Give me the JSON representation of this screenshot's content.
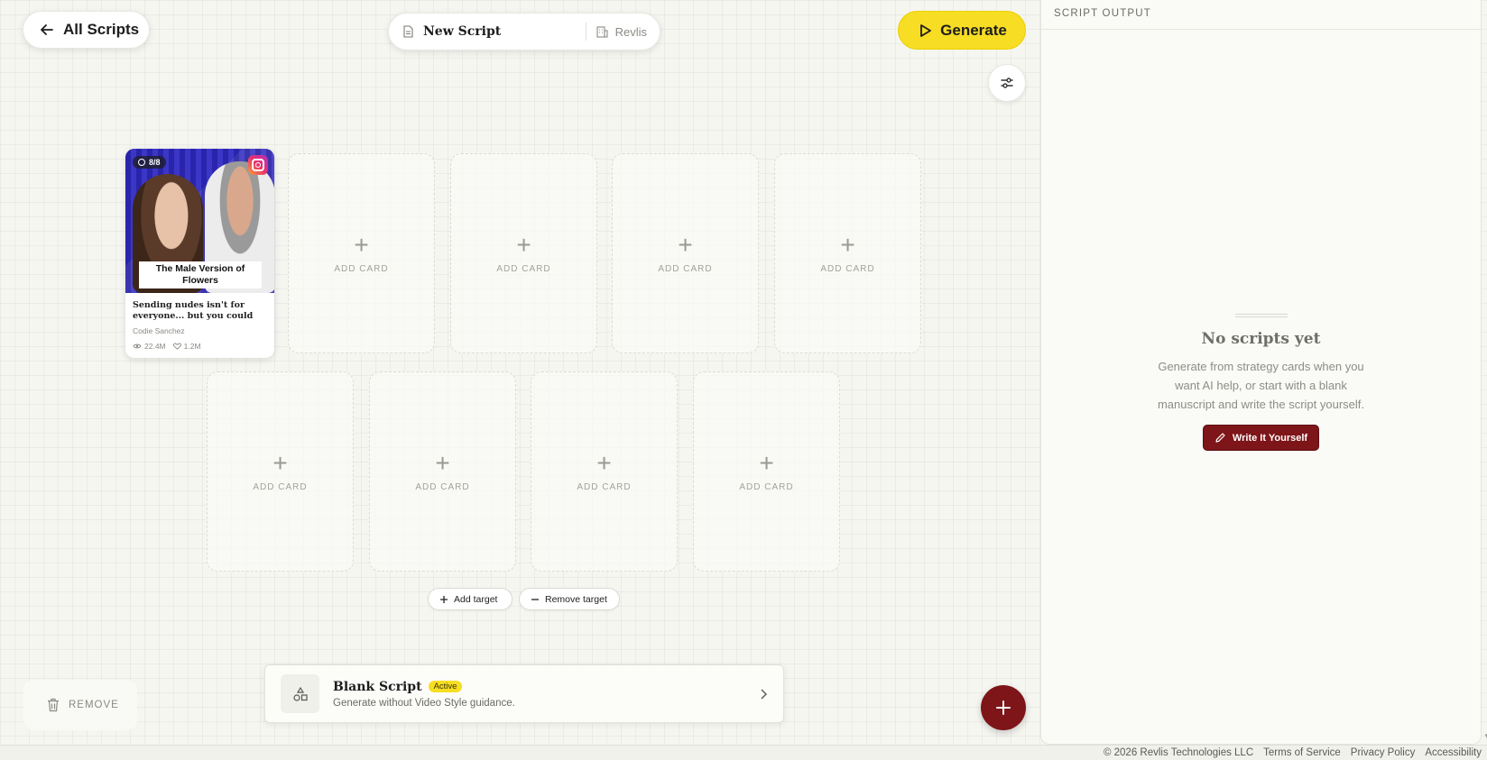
{
  "header": {
    "back_label": "All Scripts",
    "script_title": "New Script",
    "workspace": "Revlis",
    "generate_label": "Generate"
  },
  "canvas": {
    "video_card": {
      "badge": "8/8",
      "platform": "instagram",
      "caption": "The Male Version of Flowers",
      "title": "Sending nudes isn't for everyone... but you could alway...",
      "creator": "Codie Sanchez",
      "views": "22.4M",
      "likes": "1.2M"
    },
    "add_card_label": "ADD CARD",
    "add_target_label": "Add target",
    "remove_target_label": "Remove target",
    "remove_label": "REMOVE"
  },
  "style_bar": {
    "name": "Blank Script",
    "badge": "Active",
    "description": "Generate without Video Style guidance."
  },
  "output_panel": {
    "header": "SCRIPT OUTPUT",
    "empty_title": "No scripts yet",
    "empty_description": "Generate from strategy cards when you want AI help, or start with a blank manuscript and write the script yourself.",
    "write_label": "Write It Yourself"
  },
  "footer": {
    "copyright": "© 2026 Revlis Technologies LLC",
    "terms": "Terms of Service",
    "privacy": "Privacy Policy",
    "accessibility": "Accessibility"
  },
  "colors": {
    "accent_yellow": "#f7dd23",
    "accent_maroon": "#7d1519",
    "background": "#f6f6f1"
  }
}
